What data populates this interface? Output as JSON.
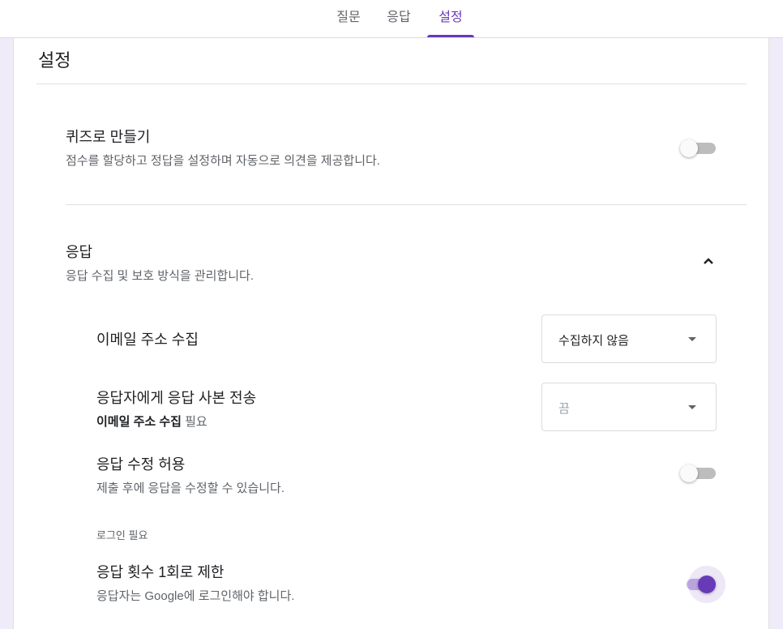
{
  "tabs": [
    {
      "label": "질문",
      "active": false
    },
    {
      "label": "응답",
      "active": false
    },
    {
      "label": "설정",
      "active": true
    }
  ],
  "settings": {
    "title": "설정",
    "quiz": {
      "title": "퀴즈로 만들기",
      "description": "점수를 할당하고 정답을 설정하며 자동으로 의견을 제공합니다.",
      "enabled": false
    },
    "responses": {
      "title": "응답",
      "description": "응답 수집 및 보호 방식을 관리합니다.",
      "expanded": true,
      "collect_email": {
        "label": "이메일 주소 수집",
        "selected": "수집하지 않음"
      },
      "send_copy": {
        "label": "응답자에게 응답 사본 전송",
        "note_bold": "이메일 주소 수집",
        "note_rest": " 필요",
        "selected": "끔"
      },
      "allow_edit": {
        "label": "응답 수정 허용",
        "description": "제출 후에 응답을 수정할 수 있습니다.",
        "enabled": false
      },
      "login_section": "로그인 필요",
      "limit_one": {
        "label": "응답 횟수 1회로 제한",
        "description": "응답자는 Google에 로그인해야 합니다.",
        "enabled": true
      }
    }
  },
  "colors": {
    "accent": "#673ab7",
    "background": "#f0ebf8"
  },
  "icons": {
    "collapse": "chevron-up-icon",
    "dropdown": "triangle-down-icon"
  }
}
